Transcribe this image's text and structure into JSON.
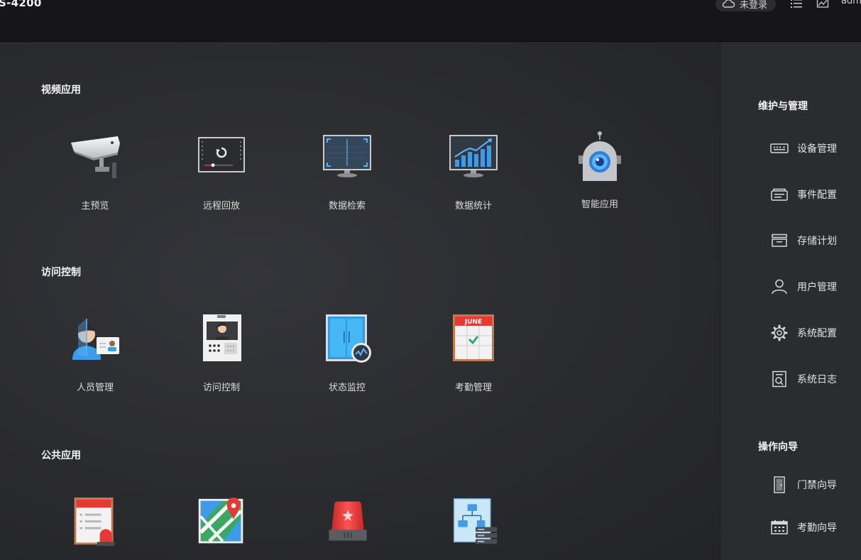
{
  "titlebar": {
    "app_title": "S-4200",
    "cloud_status": "未登录",
    "user": "adm"
  },
  "sections": [
    {
      "title": "视频应用",
      "items": [
        {
          "label": "主预览",
          "icon": "camera-icon"
        },
        {
          "label": "远程回放",
          "icon": "playback-icon"
        },
        {
          "label": "数据检索",
          "icon": "monitor-search-icon"
        },
        {
          "label": "数据统计",
          "icon": "statistics-chart-icon"
        },
        {
          "label": "智能应用",
          "icon": "robot-camera-icon"
        }
      ]
    },
    {
      "title": "访问控制",
      "items": [
        {
          "label": "人员管理",
          "icon": "person-id-icon"
        },
        {
          "label": "访问控制",
          "icon": "door-intercom-icon"
        },
        {
          "label": "状态监控",
          "icon": "door-monitor-icon"
        },
        {
          "label": "考勤管理",
          "icon": "calendar-check-icon"
        }
      ]
    },
    {
      "title": "公共应用",
      "items": [
        {
          "label": "",
          "icon": "alarm-list-icon"
        },
        {
          "label": "",
          "icon": "map-pin-icon"
        },
        {
          "label": "",
          "icon": "alarm-siren-icon"
        },
        {
          "label": "",
          "icon": "network-topology-icon"
        }
      ]
    }
  ],
  "sidebar": {
    "maintenance_title": "维护与管理",
    "maintenance_items": [
      {
        "label": "设备管理",
        "icon": "device-icon"
      },
      {
        "label": "事件配置",
        "icon": "event-icon"
      },
      {
        "label": "存储计划",
        "icon": "storage-icon"
      },
      {
        "label": "用户管理",
        "icon": "user-icon"
      },
      {
        "label": "系统配置",
        "icon": "gear-icon"
      },
      {
        "label": "系统日志",
        "icon": "log-icon"
      }
    ],
    "wizard_title": "操作向导",
    "wizard_items": [
      {
        "label": "门禁向导",
        "icon": "door-icon"
      },
      {
        "label": "考勤向导",
        "icon": "calendar-icon"
      }
    ]
  },
  "calendar_month": "JUNE",
  "colors": {
    "accent_blue": "#2f8fe6",
    "alarm_red": "#e53935",
    "background": "#27282c",
    "sidebar": "#2b2c30"
  }
}
